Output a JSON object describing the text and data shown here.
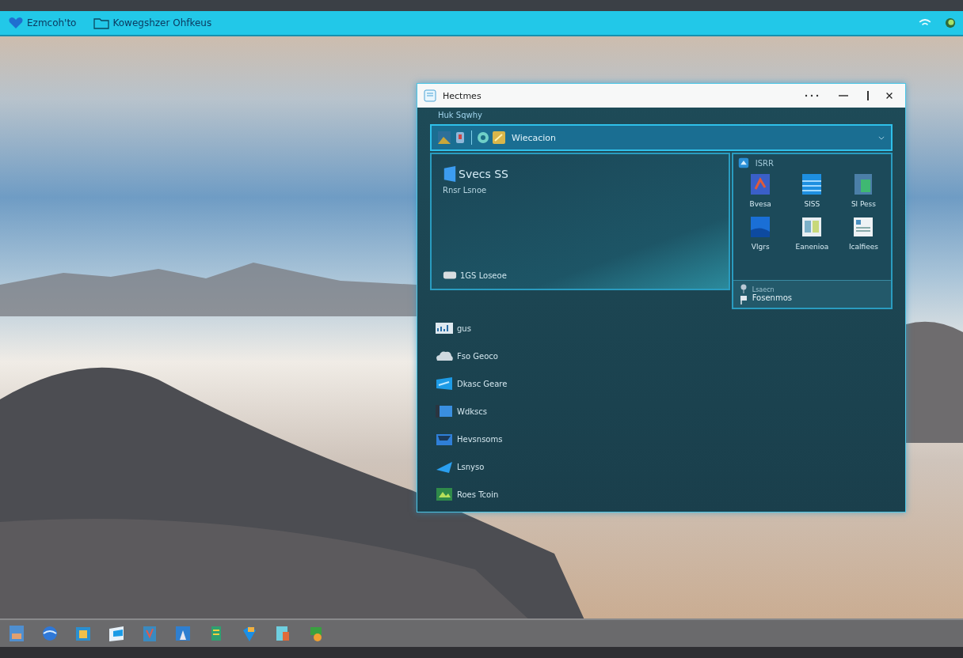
{
  "top_bar": {
    "items": [
      {
        "label": "Ezmcoh'to"
      },
      {
        "label": "Kowegshzer Ohfkeus"
      }
    ]
  },
  "window": {
    "title": "Hectmes",
    "section_label": "Huk Sqwhy",
    "address": "Wiecacion",
    "hero": {
      "title": "Svecs SS",
      "subtitle": "Rnsr Lsnoe",
      "footer": "1GS Loseoe"
    },
    "apps_panel": {
      "title": "ISRR",
      "apps": [
        {
          "label": "Bvesa"
        },
        {
          "label": "SISS"
        },
        {
          "label": "Sl Pess"
        },
        {
          "label": "Vlgrs"
        },
        {
          "label": "Eanenioa"
        },
        {
          "label": "Icalfiees"
        }
      ],
      "footer_caption": "Lsaecn",
      "footer_title": "Fosenmos"
    },
    "list": [
      {
        "label": "gus"
      },
      {
        "label": "Fso Geoco"
      },
      {
        "label": "Dkasc Geare"
      },
      {
        "label": "Wdkscs"
      },
      {
        "label": "Hevsnsoms"
      },
      {
        "label": "Lsnyso"
      },
      {
        "label": "Roes Tcoin"
      }
    ]
  }
}
